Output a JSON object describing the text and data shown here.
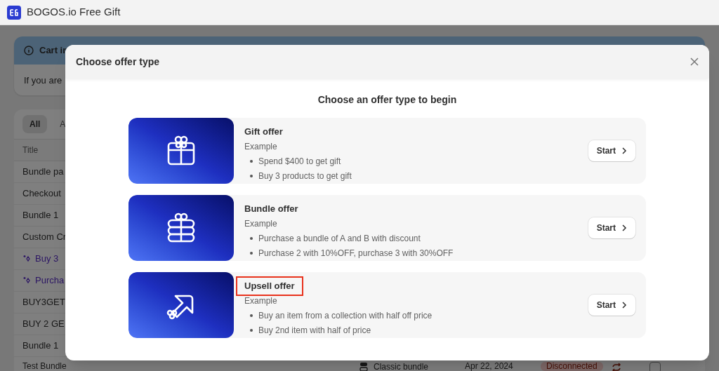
{
  "app_bar": {
    "title": "BOGOS.io Free Gift"
  },
  "banner": {
    "title": "Cart in",
    "text": "If you are"
  },
  "filter_tabs": [
    {
      "label": "All",
      "selected": true
    },
    {
      "label": "A",
      "selected": false
    }
  ],
  "table": {
    "columns": [
      "Title"
    ],
    "rows": [
      {
        "title": "Bundle pa",
        "kind": "plain"
      },
      {
        "title": "Checkout",
        "kind": "plain"
      },
      {
        "title": "Bundle 1",
        "kind": "plain"
      },
      {
        "title": "Custom Cr",
        "kind": "plain"
      },
      {
        "title": "Buy 3",
        "kind": "ai"
      },
      {
        "title": "Purcha",
        "kind": "ai"
      },
      {
        "title": "BUY3GET",
        "kind": "plain"
      },
      {
        "title": "BUY 2 GE",
        "kind": "plain"
      },
      {
        "title": "Bundle 1",
        "kind": "plain"
      },
      {
        "title": "Test Bundle",
        "kind": "plain",
        "type": "Classic bundle",
        "date": "Apr 22, 2024",
        "status": "Disconnected",
        "checked": false
      }
    ]
  },
  "modal": {
    "title": "Choose offer type",
    "heading": "Choose an offer type to begin",
    "offers": [
      {
        "kind": "gift",
        "title": "Gift offer",
        "subtitle": "Example",
        "examples": [
          "Spend $400 to get gift",
          "Buy 3 products to get gift"
        ],
        "button": "Start",
        "highlighted": false
      },
      {
        "kind": "bundle",
        "title": "Bundle offer",
        "subtitle": "Example",
        "examples": [
          "Purchase a bundle of A and B with discount",
          "Purchase 2 with 10%OFF, purchase 3 with 30%OFF"
        ],
        "button": "Start",
        "highlighted": false
      },
      {
        "kind": "upsell",
        "title": "Upsell offer",
        "subtitle": "Example",
        "examples": [
          "Buy an item from a collection with half off price",
          "Buy 2nd item with half of price"
        ],
        "button": "Start",
        "highlighted": true
      }
    ]
  }
}
